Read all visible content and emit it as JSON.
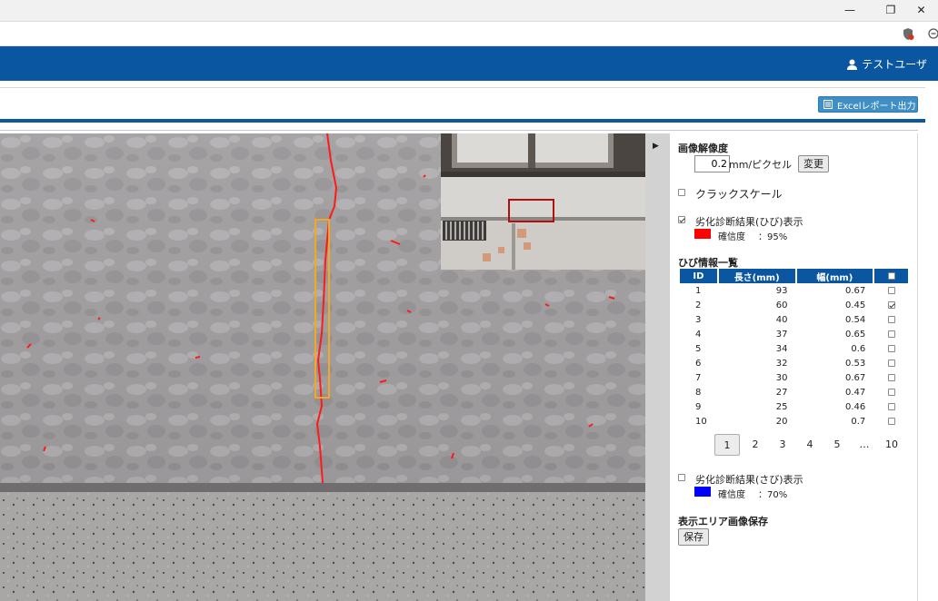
{
  "window": {
    "minimize": "—",
    "restore": "❐",
    "close": "✕"
  },
  "header": {
    "user_name": "テストユーザ"
  },
  "toolbar": {
    "excel_label": "Excelレポート出力"
  },
  "panel": {
    "resolution": {
      "title": "画像解像度",
      "value": "0.2",
      "unit": "mm/ピクセル",
      "change_label": "変更"
    },
    "crack_scale": {
      "label": "クラックスケール",
      "checked": false
    },
    "crack_result": {
      "label": "劣化診断結果(ひび)表示",
      "checked": true,
      "color": "#ff0000",
      "confidence_label": "確信度",
      "confidence_value": "：95%"
    },
    "crack_list": {
      "title": "ひび情報一覧",
      "headers": [
        "ID",
        "長さ(mm)",
        "幅(mm)"
      ],
      "rows": [
        {
          "id": "1",
          "length": "93",
          "width": "0.67",
          "checked": false
        },
        {
          "id": "2",
          "length": "60",
          "width": "0.45",
          "checked": true
        },
        {
          "id": "3",
          "length": "40",
          "width": "0.54",
          "checked": false
        },
        {
          "id": "4",
          "length": "37",
          "width": "0.65",
          "checked": false
        },
        {
          "id": "5",
          "length": "34",
          "width": "0.6",
          "checked": false
        },
        {
          "id": "6",
          "length": "32",
          "width": "0.53",
          "checked": false
        },
        {
          "id": "7",
          "length": "30",
          "width": "0.67",
          "checked": false
        },
        {
          "id": "8",
          "length": "27",
          "width": "0.47",
          "checked": false
        },
        {
          "id": "9",
          "length": "25",
          "width": "0.46",
          "checked": false
        },
        {
          "id": "10",
          "length": "20",
          "width": "0.7",
          "checked": false
        }
      ]
    },
    "pagination": {
      "pages": [
        "1",
        "2",
        "3",
        "4",
        "5",
        "…",
        "10"
      ],
      "current": "1"
    },
    "rust_result": {
      "label": "劣化診断結果(さび)表示",
      "checked": false,
      "color": "#0000ff",
      "confidence_label": "確信度",
      "confidence_value": "：70%"
    },
    "save": {
      "title": "表示エリア画像保存",
      "button_label": "保存"
    }
  },
  "colors": {
    "brand": "#0b56a0",
    "excel_button": "#3f8fc4",
    "highlight_box": "#f5a623",
    "minimap_box": "#b01010"
  },
  "icons": {
    "user": "user-icon",
    "excel": "excel-icon",
    "shield": "shield-icon",
    "zoom": "zoom-icon",
    "panel_toggle": "triangle-right-icon"
  }
}
